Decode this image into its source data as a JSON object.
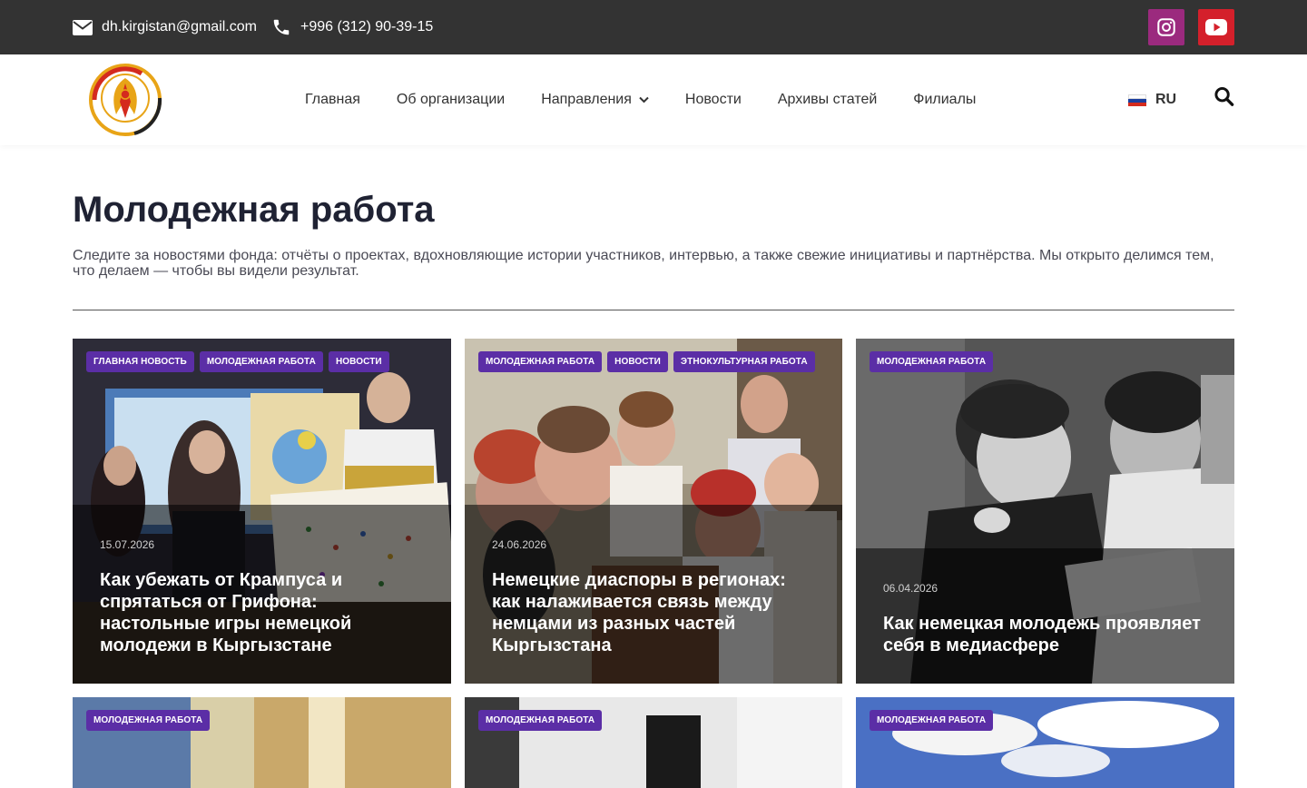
{
  "topbar": {
    "email": "dh.kirgistan@gmail.com",
    "phone": "+996 (312) 90-39-15",
    "socials": [
      {
        "name": "instagram",
        "color": "#9b2a7e"
      },
      {
        "name": "youtube",
        "color": "#d4202b"
      }
    ]
  },
  "nav": {
    "items": [
      "Главная",
      "Об организации",
      "Направления",
      "Новости",
      "Архивы статей",
      "Филиалы"
    ],
    "lang": "RU"
  },
  "hero": {
    "title": "Молодежная работа",
    "description": "Следите за новостями фонда: отчёты о проектах, вдохновляющие истории участников, интервью, а также свежие инициативы и партнёрства. Мы открыто делимся тем, что делаем — чтобы вы видели результат."
  },
  "cards": [
    {
      "tags": [
        "Главная новость",
        "Молодежная работа",
        "Новости"
      ],
      "date": "15.07.2026",
      "title": "Как убежать от Крампуса и спрятаться от Грифона: настольные игры немецкой молодежи в Кыргызстане"
    },
    {
      "tags": [
        "Молодежная работа",
        "Новости",
        "Этнокультурная работа"
      ],
      "date": "24.06.2026",
      "title": "Немецкие диаспоры в регионах: как налаживается связь между немцами из разных частей Кыргызстана"
    },
    {
      "tags": [
        "Молодежная работа"
      ],
      "date": "06.04.2026",
      "title": "Как немецкая молодежь проявляет себя в медиасфере"
    },
    {
      "tags": [
        "Молодежная работа"
      ]
    },
    {
      "tags": [
        "Молодежная работа"
      ]
    },
    {
      "tags": [
        "Молодежная работа"
      ]
    }
  ],
  "colors": {
    "topbar": "#333333",
    "tag": "#5b2ea6",
    "heading": "#1f2233"
  }
}
